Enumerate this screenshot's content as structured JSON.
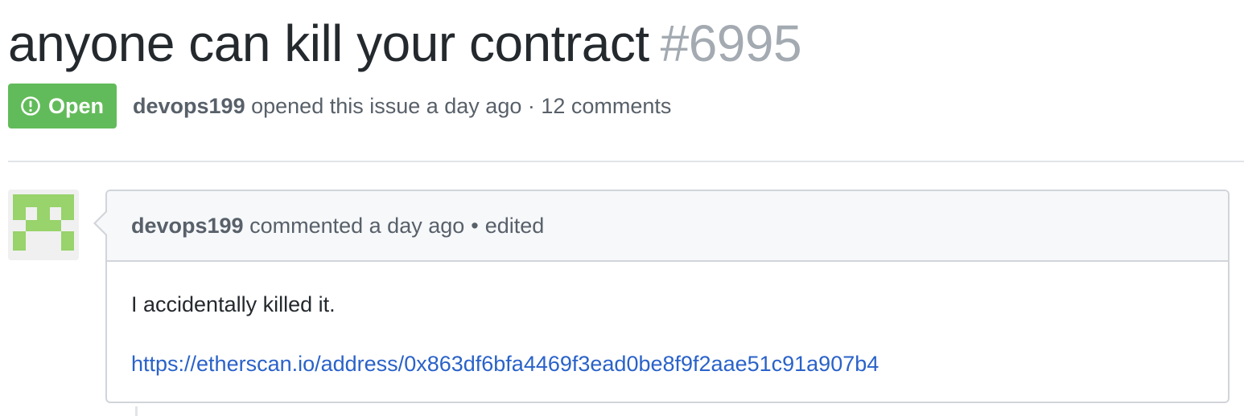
{
  "issue": {
    "title": "anyone can kill your contract",
    "number": "#6995",
    "state": "Open",
    "author": "devops199",
    "opened_text": "opened this issue a day ago · 12 comments"
  },
  "comment": {
    "author": "devops199",
    "timestamp_text": "commented a day ago",
    "bullet": "•",
    "edited": "edited",
    "body_text": "I accidentally killed it.",
    "link_text": "https://etherscan.io/address/0x863df6bfa4469f3ead0be8f9f2aae51c91a907b4"
  },
  "colors": {
    "open_badge": "#62bb5a",
    "link": "#2a62c9",
    "avatar_identicon": "#98d36b"
  },
  "icons": {
    "state_icon": "issue-opened-icon"
  }
}
